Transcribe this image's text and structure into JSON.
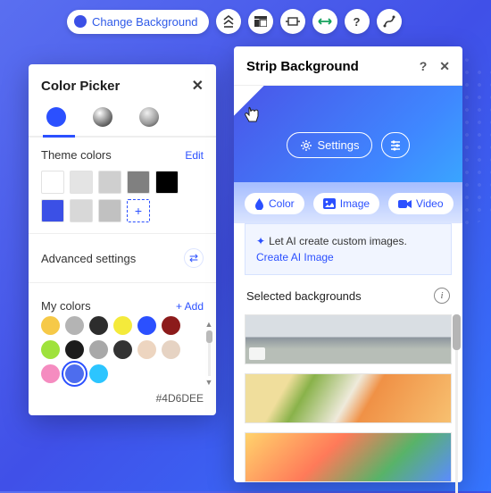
{
  "toolbar": {
    "change_bg_label": "Change Background",
    "icons": [
      "scroll-top-icon",
      "layout-icon",
      "stretch-icon",
      "width-icon",
      "help-icon",
      "path-icon"
    ]
  },
  "color_picker": {
    "title": "Color Picker",
    "theme_label": "Theme colors",
    "edit_label": "Edit",
    "theme_colors": [
      "#FFFFFF",
      "#E4E4E4",
      "#CFCFCF",
      "#808080",
      "#000000",
      "#3B50E6",
      "#D8D8D8",
      "#C1C1C1"
    ],
    "add_swatch_label": "+",
    "advanced_label": "Advanced settings",
    "my_colors_label": "My colors",
    "add_label": "+ Add",
    "my_colors": [
      "#F6C948",
      "#B4B4B4",
      "#2D2D2D",
      "#F4EA3B",
      "#2B50FF",
      "#8C1B1B",
      "#9FE23C",
      "#1C1C1C",
      "#A8A8A8",
      "#333333",
      "#EDD5C0",
      "#E6D3C3",
      "#F58CC0",
      "#4D6DEE",
      "#2CC5FF"
    ],
    "selected_index": 13,
    "hex_value": "#4D6DEE"
  },
  "strip": {
    "title": "Strip Background",
    "help_label": "?",
    "settings_label": "Settings",
    "tabs": {
      "color": "Color",
      "image": "Image",
      "video": "Video"
    },
    "ai_text": "Let AI create custom images. ",
    "ai_link": "Create AI Image",
    "selected_label": "Selected backgrounds"
  }
}
